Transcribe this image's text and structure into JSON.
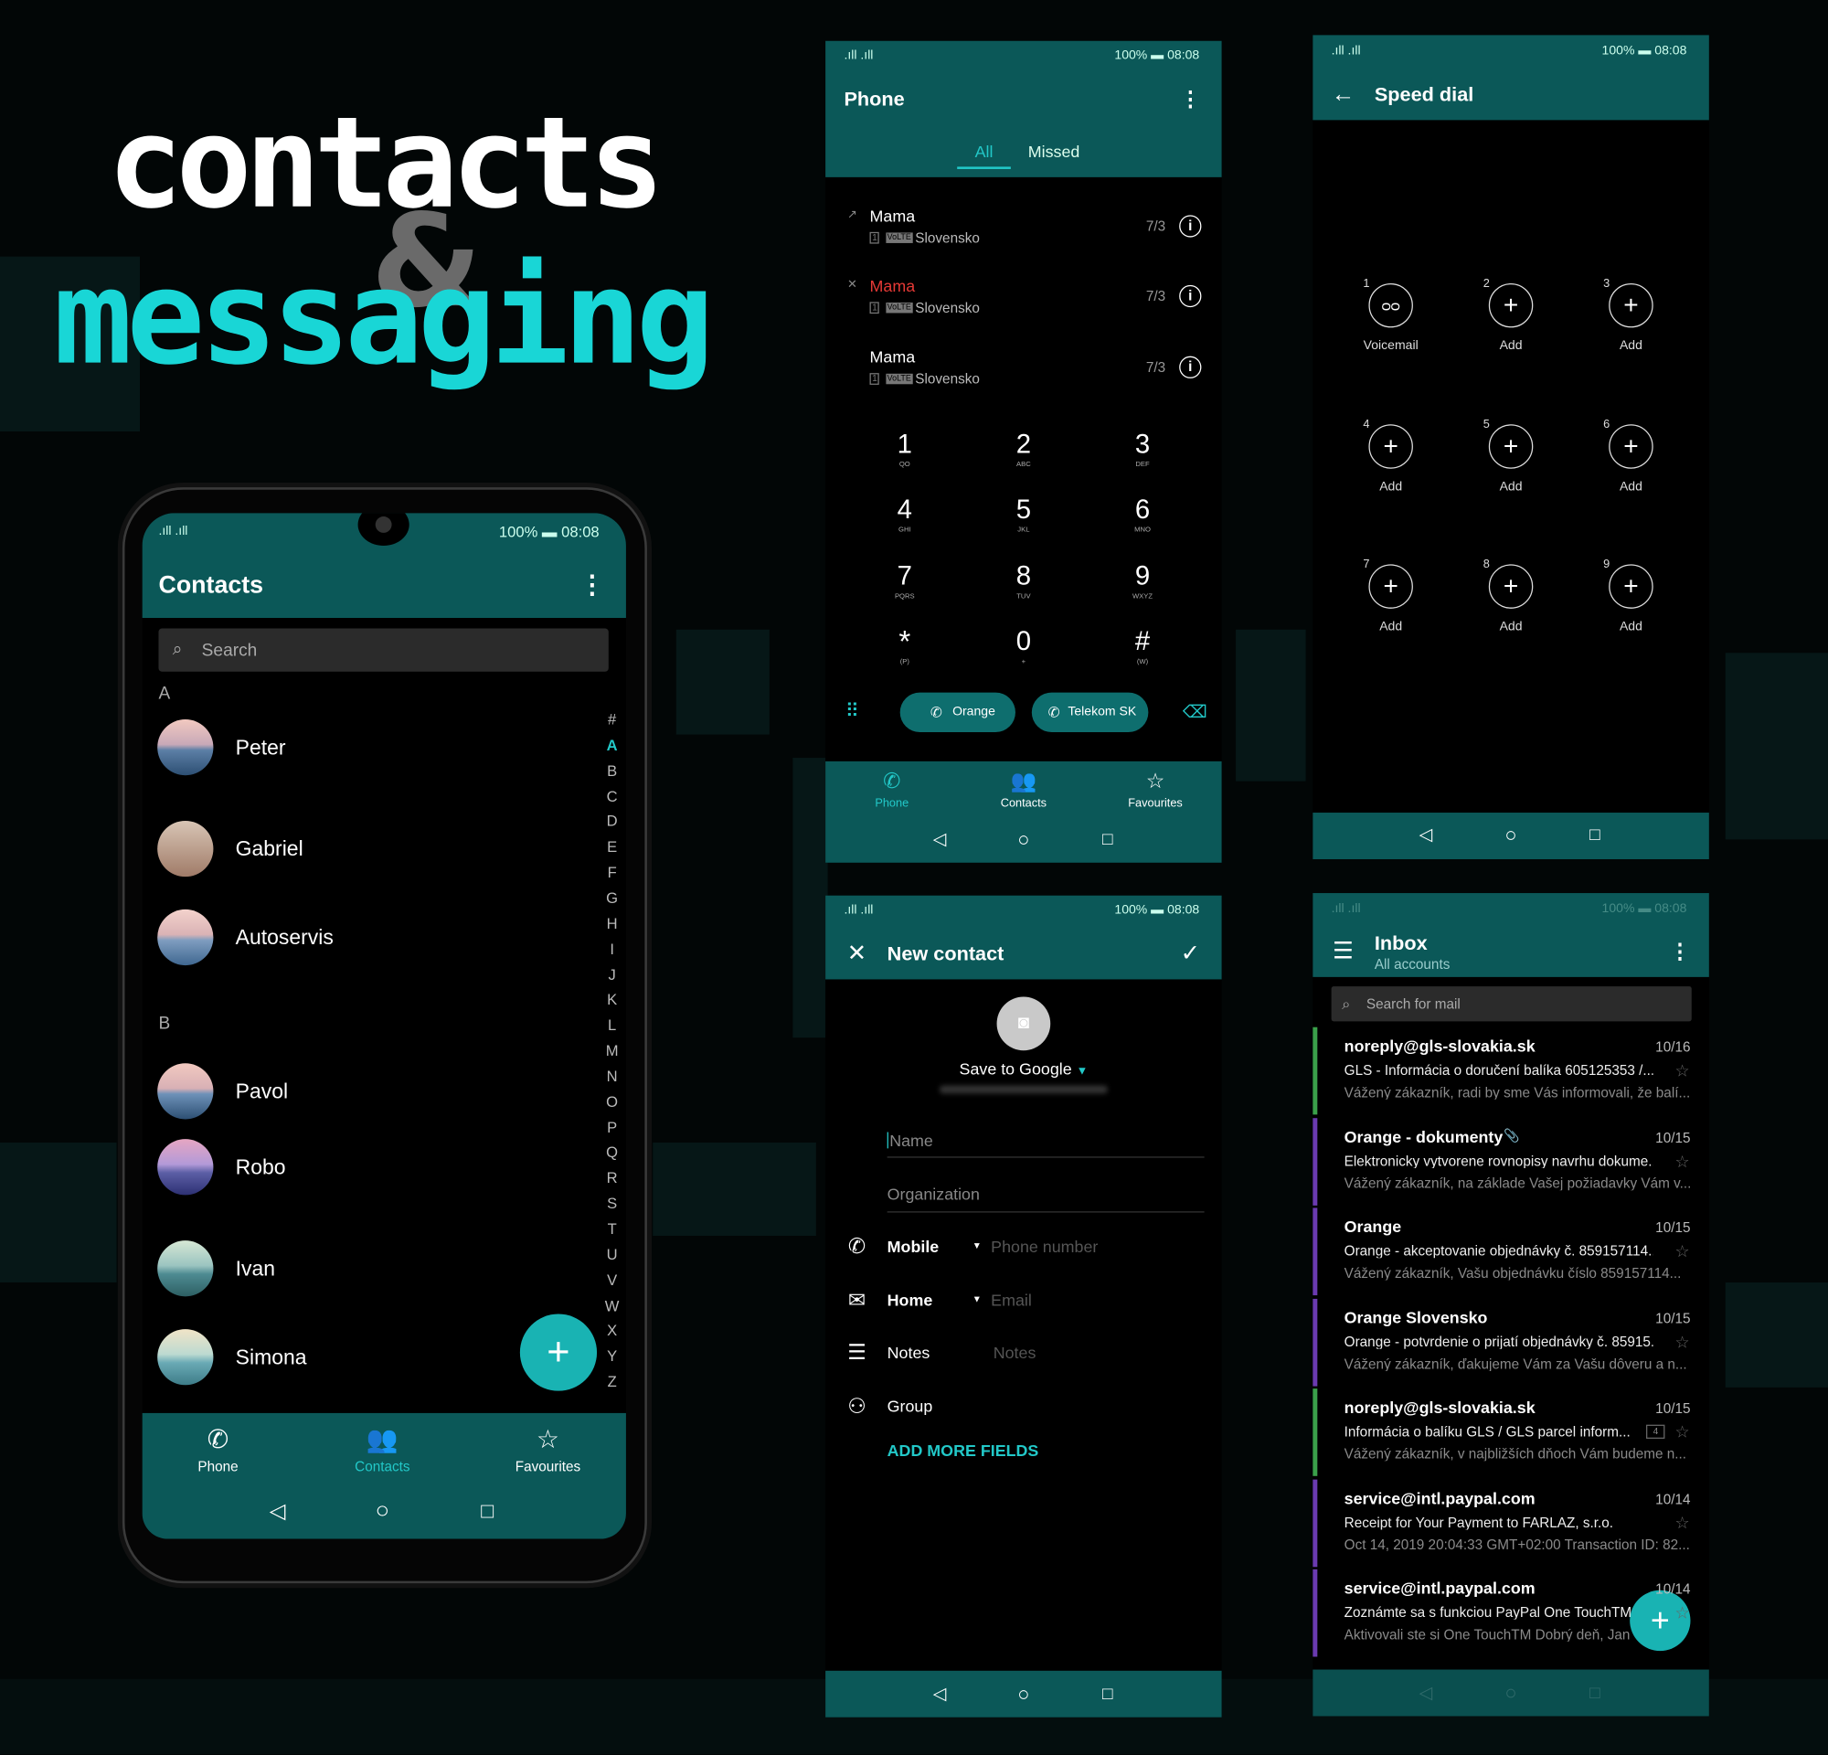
{
  "poster": {
    "title_line1": "contacts",
    "ampersand": "&",
    "title_line2": "messaging"
  },
  "colors": {
    "teal": "#0b5858",
    "accent": "#22c8c8",
    "missed_red": "#e53935",
    "fab": "#19b3b3",
    "bar_green": "#3aa04a",
    "bar_purple": "#6a3ab0"
  },
  "status": {
    "battery": "100%",
    "time": "08:08"
  },
  "contacts_app": {
    "title": "Contacts",
    "search_placeholder": "Search",
    "sections": [
      {
        "letter": "A",
        "items": [
          "Peter",
          "Gabriel",
          "Autoservis"
        ]
      },
      {
        "letter": "B",
        "items": [
          "Pavol",
          "Robo",
          "Ivan",
          "Simona"
        ]
      }
    ],
    "index": [
      "#",
      "A",
      "B",
      "C",
      "D",
      "E",
      "F",
      "G",
      "H",
      "I",
      "J",
      "K",
      "L",
      "M",
      "N",
      "O",
      "P",
      "Q",
      "R",
      "S",
      "T",
      "U",
      "V",
      "W",
      "X",
      "Y",
      "Z"
    ],
    "active_index": "A",
    "nav": [
      "Phone",
      "Contacts",
      "Favourites"
    ],
    "active_nav": "Contacts"
  },
  "phone_app": {
    "title": "Phone",
    "tabs": [
      "All",
      "Missed"
    ],
    "active_tab": "All",
    "calls": [
      {
        "name": "Mama",
        "sub": "Slovensko",
        "badge": "VoLTE",
        "date": "7/3",
        "type": "outgoing"
      },
      {
        "name": "Mama",
        "sub": "Slovensko",
        "badge": "VoLTE",
        "date": "7/3",
        "type": "missed"
      },
      {
        "name": "Mama",
        "sub": "Slovensko",
        "badge": "VoLTE",
        "date": "7/3",
        "type": "incoming"
      }
    ],
    "keys": [
      {
        "d": "1",
        "l": "QO"
      },
      {
        "d": "2",
        "l": "ABC"
      },
      {
        "d": "3",
        "l": "DEF"
      },
      {
        "d": "4",
        "l": "GHI"
      },
      {
        "d": "5",
        "l": "JKL"
      },
      {
        "d": "6",
        "l": "MNO"
      },
      {
        "d": "7",
        "l": "PQRS"
      },
      {
        "d": "8",
        "l": "TUV"
      },
      {
        "d": "9",
        "l": "WXYZ"
      },
      {
        "d": "*",
        "l": "(P)"
      },
      {
        "d": "0",
        "l": "+"
      },
      {
        "d": "#",
        "l": "(W)"
      }
    ],
    "call_buttons": [
      "Orange",
      "Telekom SK"
    ],
    "nav": [
      "Phone",
      "Contacts",
      "Favourites"
    ],
    "active_nav": "Phone"
  },
  "speed_dial": {
    "title": "Speed dial",
    "slots": [
      {
        "n": "1",
        "label": "Voicemail",
        "icon": "voicemail-icon"
      },
      {
        "n": "2",
        "label": "Add",
        "icon": "plus-icon"
      },
      {
        "n": "3",
        "label": "Add",
        "icon": "plus-icon"
      },
      {
        "n": "4",
        "label": "Add",
        "icon": "plus-icon"
      },
      {
        "n": "5",
        "label": "Add",
        "icon": "plus-icon"
      },
      {
        "n": "6",
        "label": "Add",
        "icon": "plus-icon"
      },
      {
        "n": "7",
        "label": "Add",
        "icon": "plus-icon"
      },
      {
        "n": "8",
        "label": "Add",
        "icon": "plus-icon"
      },
      {
        "n": "9",
        "label": "Add",
        "icon": "plus-icon"
      }
    ]
  },
  "new_contact": {
    "title": "New contact",
    "save_to": "Save to Google",
    "name_placeholder": "Name",
    "organization_placeholder": "Organization",
    "rows": [
      {
        "label": "Mobile",
        "value": "Phone number",
        "dropdown": true,
        "icon": "phone-icon"
      },
      {
        "label": "Home",
        "value": "Email",
        "dropdown": true,
        "icon": "mail-icon"
      },
      {
        "label": "Notes",
        "value": "Notes",
        "dropdown": false,
        "icon": "notes-icon"
      },
      {
        "label": "Group",
        "value": "",
        "dropdown": false,
        "icon": "group-icon"
      }
    ],
    "add_more": "ADD MORE FIELDS"
  },
  "inbox": {
    "title": "Inbox",
    "subtitle": "All accounts",
    "search_placeholder": "Search for mail",
    "emails": [
      {
        "from": "noreply@gls-slovakia.sk",
        "date": "10/16",
        "subject": "GLS - Informácia o doručení balíka 605125353 /...",
        "preview": "Vážený zákazník, radi by sme Vás informovali, že balí...",
        "bar": "green",
        "attachment": false,
        "count": ""
      },
      {
        "from": "Orange - dokumenty",
        "date": "10/15",
        "subject": "Elektronicky vytvorene rovnopisy navrhu dokume...",
        "preview": "Vážený zákazník, na základe Vašej požiadavky Vám v...",
        "bar": "purple",
        "attachment": true,
        "count": ""
      },
      {
        "from": "Orange",
        "date": "10/15",
        "subject": "Orange - akceptovanie objednávky č. 859157114...",
        "preview": "Vážený zákazník, Vašu objednávku číslo 859157114...",
        "bar": "purple",
        "attachment": false,
        "count": ""
      },
      {
        "from": "Orange Slovensko",
        "date": "10/15",
        "subject": "Orange - potvrdenie o prijatí objednávky č. 85915...",
        "preview": "Vážený zákazník, ďakujeme Vám za Vašu dôveru a n...",
        "bar": "purple",
        "attachment": false,
        "count": ""
      },
      {
        "from": "noreply@gls-slovakia.sk",
        "date": "10/15",
        "subject": "Informácia o balíku GLS / GLS parcel inform...",
        "preview": "Vážený zákazník, v najbližších dňoch Vám budeme n...",
        "bar": "green",
        "attachment": false,
        "count": "4"
      },
      {
        "from": "service@intl.paypal.com",
        "date": "10/14",
        "subject": "Receipt for Your Payment to FARLAZ, s.r.o.",
        "preview": "Oct 14, 2019 20:04:33 GMT+02:00 Transaction ID: 82...",
        "bar": "purple",
        "attachment": false,
        "count": ""
      },
      {
        "from": "service@intl.paypal.com",
        "date": "10/14",
        "subject": "Zoznámte sa s funkciou PayPal One TouchTM",
        "preview": "Aktivovali ste si One TouchTM Dobrý deň, Jan",
        "bar": "purple",
        "attachment": false,
        "count": ""
      }
    ]
  }
}
